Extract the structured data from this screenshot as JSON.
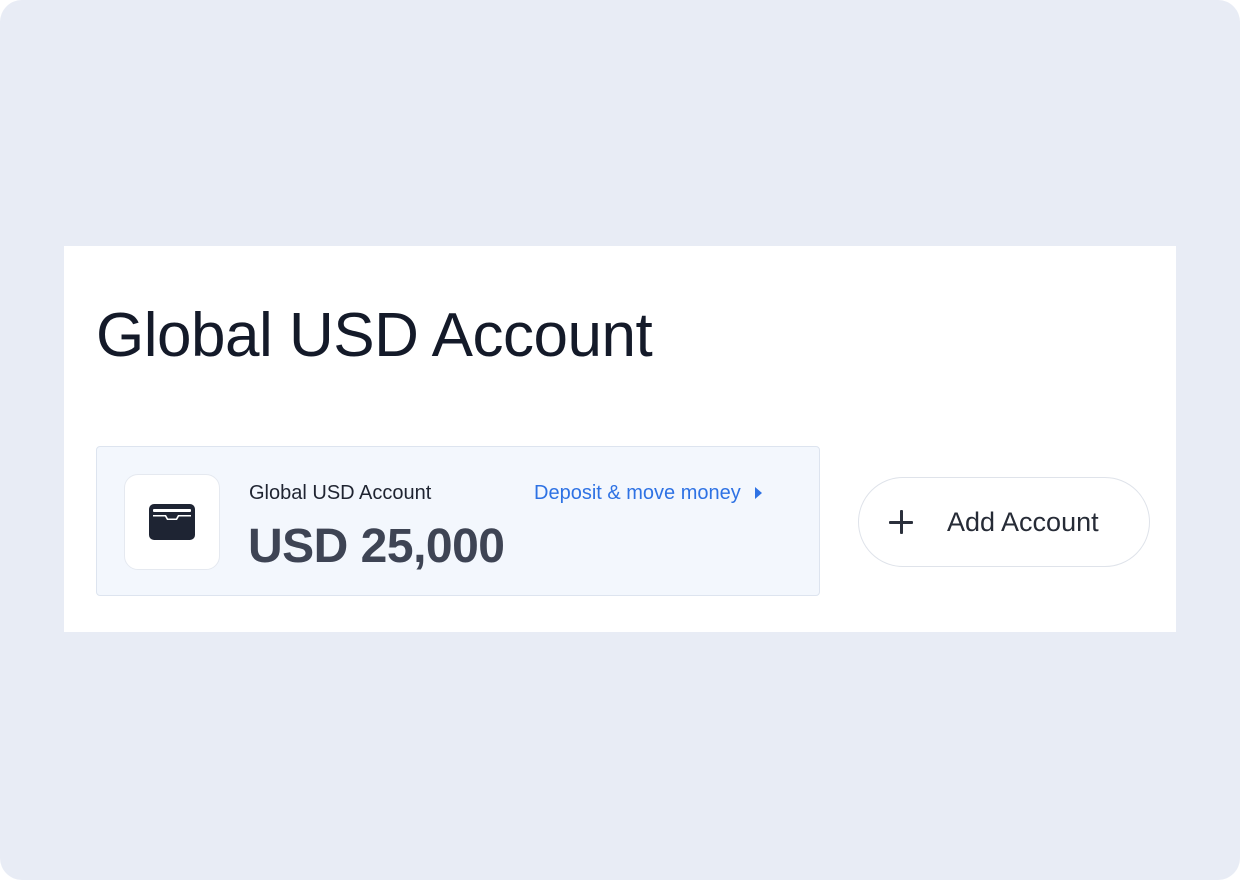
{
  "page": {
    "title": "Global USD Account"
  },
  "account_card": {
    "name": "Global USD Account",
    "balance": "USD 25,000",
    "deposit_link": "Deposit & move money",
    "icon": "wallet-icon"
  },
  "actions": {
    "add_account_label": "Add Account",
    "add_icon": "plus-icon"
  },
  "colors": {
    "link_blue": "#2e72e4",
    "card_background": "#f3f7fd",
    "page_background": "#e8ecf5"
  }
}
